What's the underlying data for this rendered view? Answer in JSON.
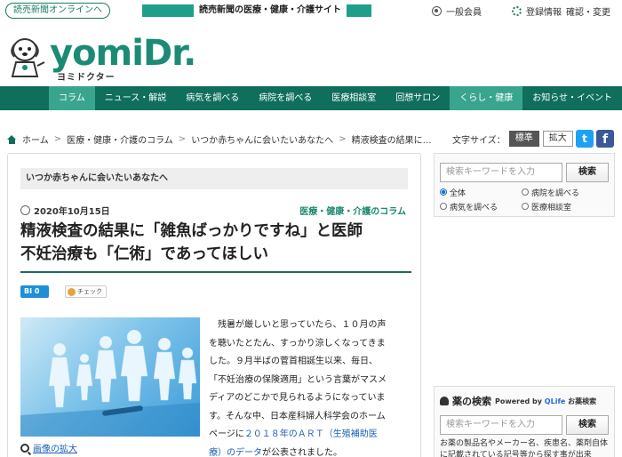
{
  "topbar": {
    "yomiuri_link": "読売新聞オンラインへ",
    "site_banner": "読売新聞の医療・健康・介護サイト",
    "member_label": "一般会員",
    "register_label": "登録情報",
    "register_sub": "確認・変更"
  },
  "logo": {
    "main": "yomiDr.",
    "sub": "ヨミドクター",
    "mascot_icon": "dog-doctor-mascot-icon",
    "brand_color": "#1c8b74"
  },
  "nav": {
    "items": [
      {
        "label": "コラム",
        "active": true
      },
      {
        "label": "ニュース・解説",
        "active": false
      },
      {
        "label": "病気を調べる",
        "active": false
      },
      {
        "label": "病院を調べる",
        "active": false
      },
      {
        "label": "医療相談室",
        "active": false
      },
      {
        "label": "回想サロン",
        "active": false
      },
      {
        "label": "くらし・健康",
        "active": true
      },
      {
        "label": "お知らせ・イベント",
        "active": false
      }
    ],
    "color": "#0f6e5c",
    "active_color": "#3aa58f"
  },
  "breadcrumb": {
    "home": "ホーム",
    "level1": "医療・健康・介護のコラム",
    "level2": "いつか赤ちゃんに会いたいあなたへ",
    "level3": "精液検査の結果に…"
  },
  "textsize": {
    "label": "文字サイズ：",
    "standard": "標準",
    "large": "拡大"
  },
  "social": {
    "twitter_glyph": "t",
    "facebook_glyph": "f"
  },
  "article": {
    "series": "いつか赤ちゃんに会いたいあなたへ",
    "date": "2020年10月15日",
    "category": "医療・健康・介護のコラム",
    "headline_line1": "精液検査の結果に「雑魚ばっかりですね」と医師",
    "headline_line2": "不妊治療も「仁術」であってほしい",
    "bi_badge": "BI 0",
    "check_badge": "チェック",
    "enlarge_link": "画像の拡大",
    "body_lines": [
      "　残暑が厳しいと思っていたら、１０月の声",
      "を聴いたとたん、すっかり涼しくなってきま",
      "した。９月半ばの菅首相誕生以来、毎日、",
      "「不妊治療の保険適用」という言葉がマスメ",
      "ディアのどこかで見られるようになっていま",
      "す。そんな中、日本産科婦人科学会のホーム",
      "ページに"
    ],
    "body_link1": "２０１８年のＡＲＴ（生殖補助医",
    "body_link2": "療）のデータ",
    "body_tail": "が公表されました。"
  },
  "sidebar": {
    "search_placeholder": "検索キーワードを入力",
    "search_button": "検索",
    "radios": [
      {
        "label": "全体",
        "checked": true
      },
      {
        "label": "病院を調べる",
        "checked": false
      },
      {
        "label": "病気を調べる",
        "checked": false
      },
      {
        "label": "医療相談室",
        "checked": false
      }
    ],
    "drug_title": "薬の検索",
    "drug_powered": "Powered by",
    "drug_brand": "QLife",
    "drug_brand_tail": "お薬検索",
    "drug_placeholder": "検索キーワードを入力",
    "drug_button": "検索",
    "drug_desc": "お薬の製品名やメーカー名、疾患名、薬剤自体に記載されている記号等から探す事が出来"
  }
}
